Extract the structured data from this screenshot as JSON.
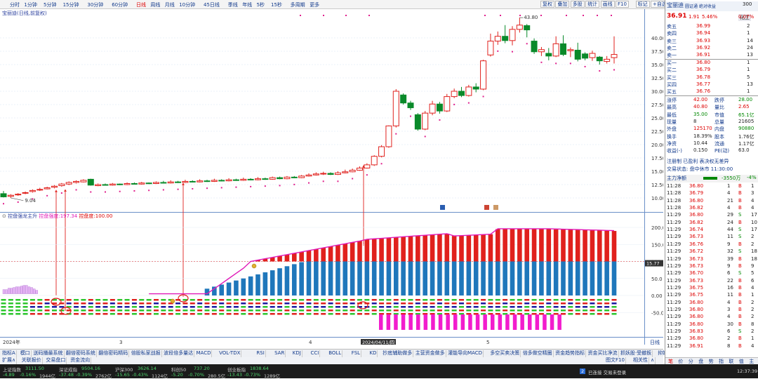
{
  "topbar": {
    "periods": [
      "分时",
      "1分钟",
      "5分钟",
      "15分钟",
      "30分钟",
      "60分钟",
      "日线",
      "周线",
      "月线",
      "10分钟",
      "45日线",
      "季线",
      "年线",
      "5秒",
      "15秒",
      "多周期",
      "更多"
    ],
    "active": "日线",
    "tools": [
      "复权",
      "叠加",
      "多股",
      "统计",
      "画线",
      "F10",
      "标记",
      "+自选",
      "返回"
    ]
  },
  "chart": {
    "title": "宝丽迪(日线,前复权)",
    "y_ticks": [
      "40.00",
      "37.50",
      "35.00",
      "32.50",
      "30.00",
      "27.50",
      "25.00",
      "22.50",
      "20.00",
      "17.50",
      "15.00",
      "12.50",
      "10.00"
    ],
    "high_label": "43.80",
    "low_label": "9.04",
    "x_labels": [
      "2024年",
      "3",
      "4",
      "5"
    ],
    "date_label": "2024/04/11/四",
    "chip_label": "日线",
    "price_tag": "15.77",
    "candles": [
      [
        10.8,
        10.2,
        11.3,
        10.1
      ],
      [
        10.3,
        10.5,
        10.7,
        10.0
      ],
      [
        10.6,
        10.7,
        10.9,
        10.4
      ],
      [
        10.9,
        11.0,
        11.2,
        10.7
      ],
      [
        11.2,
        11.4,
        11.6,
        11.0
      ],
      [
        11.5,
        11.6,
        11.9,
        11.3
      ],
      [
        11.7,
        11.9,
        12.1,
        11.6
      ],
      [
        12.0,
        12.2,
        12.4,
        11.8
      ],
      [
        12.3,
        12.6,
        12.8,
        12.1
      ],
      [
        12.6,
        12.9,
        13.1,
        12.4
      ],
      [
        12.9,
        13.1,
        13.3,
        12.7
      ],
      [
        13.0,
        13.3,
        13.5,
        12.9
      ],
      [
        13.5,
        12.4,
        13.6,
        12.3
      ],
      [
        12.3,
        12.5,
        12.7,
        12.2
      ],
      [
        12.5,
        12.4,
        12.7,
        12.3
      ],
      [
        12.4,
        12.6,
        12.8,
        12.3
      ],
      [
        12.6,
        12.5,
        12.7,
        12.4
      ],
      [
        12.5,
        12.7,
        12.9,
        12.4
      ],
      [
        12.7,
        12.6,
        12.9,
        12.5
      ],
      [
        12.6,
        12.8,
        13.0,
        12.5
      ],
      [
        12.8,
        12.7,
        12.9,
        12.6
      ],
      [
        12.7,
        12.9,
        13.1,
        12.6
      ],
      [
        12.9,
        12.8,
        13.2,
        12.7
      ],
      [
        12.8,
        13.0,
        13.3,
        12.7
      ],
      [
        13.0,
        12.9,
        13.2,
        12.8
      ],
      [
        12.9,
        13.1,
        13.4,
        12.8
      ],
      [
        13.1,
        13.0,
        13.3,
        12.9
      ],
      [
        13.0,
        13.2,
        13.5,
        12.9
      ],
      [
        13.2,
        13.1,
        13.4,
        13.0
      ],
      [
        13.1,
        13.3,
        13.6,
        13.0
      ],
      [
        13.3,
        13.2,
        13.5,
        13.1
      ],
      [
        13.2,
        13.4,
        13.7,
        13.1
      ],
      [
        13.4,
        13.3,
        13.6,
        13.2
      ],
      [
        13.3,
        13.5,
        13.8,
        13.2
      ],
      [
        13.5,
        13.4,
        13.7,
        13.3
      ],
      [
        13.4,
        13.6,
        13.9,
        13.3
      ],
      [
        13.6,
        13.5,
        13.8,
        13.4
      ],
      [
        13.5,
        13.8,
        14.0,
        13.4
      ],
      [
        13.8,
        13.6,
        14.0,
        13.5
      ],
      [
        13.6,
        13.9,
        14.1,
        13.5
      ],
      [
        13.9,
        13.8,
        14.1,
        13.7
      ],
      [
        13.8,
        14.1,
        14.3,
        13.7
      ],
      [
        14.1,
        14.3,
        14.6,
        14.0
      ],
      [
        14.3,
        14.5,
        14.8,
        14.2
      ],
      [
        14.5,
        14.6,
        14.9,
        14.3
      ],
      [
        14.6,
        14.4,
        14.8,
        14.3
      ],
      [
        14.4,
        14.7,
        15.0,
        14.3
      ],
      [
        14.7,
        14.9,
        15.3,
        14.6
      ],
      [
        14.9,
        15.2,
        15.5,
        14.8
      ],
      [
        15.2,
        15.6,
        15.9,
        15.1
      ],
      [
        15.6,
        16.2,
        16.5,
        15.5
      ],
      [
        16.2,
        17.8,
        18.0,
        16.0
      ],
      [
        17.8,
        19.6,
        19.9,
        17.6
      ],
      [
        19.6,
        23.5,
        23.6,
        19.4
      ],
      [
        23.5,
        30.0,
        30.4,
        23.2
      ],
      [
        29.3,
        27.8,
        29.6,
        27.5
      ],
      [
        27.8,
        26.9,
        28.2,
        26.5
      ],
      [
        25.6,
        22.9,
        25.9,
        22.6
      ],
      [
        22.9,
        25.9,
        26.3,
        22.7
      ],
      [
        25.9,
        27.6,
        28.2,
        25.5
      ],
      [
        27.6,
        26.3,
        28.0,
        25.8
      ],
      [
        26.3,
        29.0,
        29.5,
        26.1
      ],
      [
        29.0,
        30.0,
        30.5,
        28.7
      ],
      [
        30.0,
        29.2,
        30.8,
        28.9
      ],
      [
        29.2,
        30.8,
        31.2,
        29.0
      ],
      [
        30.8,
        30.4,
        31.5,
        29.8
      ],
      [
        30.4,
        35.7,
        35.9,
        30.2
      ],
      [
        36.8,
        39.4,
        40.8,
        36.5
      ],
      [
        39.4,
        40.3,
        41.2,
        38.7
      ],
      [
        40.3,
        39.5,
        42.4,
        39.0
      ],
      [
        39.5,
        41.6,
        42.2,
        38.6
      ],
      [
        41.6,
        42.4,
        43.8,
        41.0
      ],
      [
        42.3,
        41.5,
        42.6,
        40.1
      ],
      [
        39.4,
        37.4,
        39.9,
        37.0
      ],
      [
        37.4,
        37.8,
        38.3,
        36.6
      ],
      [
        37.1,
        36.6,
        38.1,
        35.8
      ],
      [
        36.6,
        38.9,
        40.3,
        36.4
      ],
      [
        38.9,
        36.9,
        40.5,
        36.6
      ],
      [
        37.6,
        37.8,
        38.2,
        36.4
      ],
      [
        37.7,
        36.0,
        39.1,
        35.6
      ],
      [
        37.0,
        36.2,
        37.3,
        35.8
      ],
      [
        36.3,
        37.1,
        37.6,
        35.7
      ],
      [
        36.4,
        35.7,
        36.6,
        35.0
      ],
      [
        35.6,
        36.0,
        36.6,
        35.2
      ],
      [
        36.3,
        36.9,
        40.3,
        35.2
      ]
    ]
  },
  "indicator": {
    "name": "控盘强龙主升",
    "line1_label": "控盘强度:",
    "line1_value": "197.34",
    "line2_label": "控盘度:",
    "line2_value": "100.00",
    "y_ticks": [
      "200.0",
      "150.0",
      "100.0",
      "50.0",
      "0.00",
      "-50.0"
    ],
    "curve": [
      5,
      5,
      5,
      5,
      5,
      5,
      5,
      5,
      5,
      5,
      5,
      5,
      5,
      5,
      5,
      5,
      5,
      5,
      5,
      5,
      5,
      5,
      5,
      5,
      5,
      5,
      5,
      5,
      5,
      5,
      5,
      5,
      5,
      5,
      5,
      5,
      5,
      5,
      5,
      5,
      5,
      5,
      5,
      5,
      5,
      5,
      5,
      10,
      18,
      28,
      40,
      55,
      70,
      85,
      100,
      112,
      120,
      130,
      140,
      150,
      155,
      160,
      165,
      170,
      173,
      175,
      177,
      178,
      180,
      181,
      182,
      183,
      184,
      184,
      185,
      186,
      186,
      187,
      188,
      189,
      190,
      190,
      190,
      191,
      192,
      193,
      194,
      195,
      196,
      197,
      197,
      198,
      199,
      200,
      201,
      202,
      203,
      204,
      205,
      205,
      205,
      205,
      205,
      205,
      205,
      205,
      205,
      205,
      205,
      205,
      205,
      205,
      205,
      205,
      205,
      205,
      205,
      205,
      205,
      205,
      205,
      205,
      205,
      205,
      205,
      205,
      205,
      205,
      205,
      205,
      205,
      205,
      205,
      205,
      205,
      205,
      205,
      205,
      205,
      205,
      205,
      205,
      205,
      205,
      205,
      205,
      205,
      205,
      205,
      205,
      205,
      205,
      205,
      205,
      205,
      205,
      205,
      205,
      205,
      205,
      205,
      205,
      205,
      205,
      205,
      205,
      205,
      205,
      205,
      205,
      205,
      205,
      205,
      205,
      205,
      205,
      205,
      205,
      205,
      205,
      205,
      205,
      205,
      205,
      205,
      205,
      205,
      205,
      205,
      205,
      205,
      205,
      205,
      205,
      205,
      205,
      205,
      205,
      205,
      205,
      205,
      205,
      205,
      205,
      205,
      205,
      205,
      205,
      205,
      205,
      205,
      205,
      205,
      205,
      205,
      205,
      205,
      205,
      205,
      205,
      205,
      205,
      205,
      205,
      205,
      205,
      205,
      205,
      205
    ]
  },
  "quote": {
    "name": "宝丽迪",
    "sector": "化工",
    "ticker": "300",
    "subtitle": "圆证通 绝对收益",
    "price": "36.91",
    "change": "1.91",
    "pct": "5.46%",
    "weibi": "0.07%",
    "asks": [
      [
        "卖五",
        "36.99",
        "2"
      ],
      [
        "卖四",
        "36.94",
        "1"
      ],
      [
        "卖三",
        "36.93",
        "14"
      ],
      [
        "卖二",
        "36.92",
        "24"
      ],
      [
        "卖一",
        "36.91",
        "13"
      ]
    ],
    "bids": [
      [
        "买一",
        "36.80",
        "1"
      ],
      [
        "买二",
        "36.79",
        "1"
      ],
      [
        "买三",
        "36.78",
        "5"
      ],
      [
        "买四",
        "36.77",
        "13"
      ],
      [
        "买五",
        "36.76",
        "1"
      ]
    ],
    "stats": [
      [
        "涨停",
        "42.00",
        "跌停",
        "28.00"
      ],
      [
        "最高",
        "40.80",
        "量比",
        "2.65"
      ],
      [
        "最低",
        "35.00",
        "市值",
        "65.1亿"
      ],
      [
        "现量",
        "8",
        "总量",
        "21605"
      ],
      [
        "外盘",
        "125170",
        "内盘",
        "90880"
      ],
      [
        "换手",
        "18.39%",
        "股本",
        "1.76亿"
      ],
      [
        "净资",
        "10.44",
        "流通",
        "1.17亿"
      ],
      [
        "收益(-)",
        "0.150",
        "PE(动)",
        "63.0"
      ]
    ],
    "tags": "注册制 已盈利 表决权无差异",
    "status": "交易状态: 盘中休市 11:30:00",
    "flow_label": "主力净额",
    "flow_value": "-3550万",
    "flow_pct": "-4%",
    "ticks": [
      [
        "11:28",
        "36.80",
        "1",
        "B",
        "1"
      ],
      [
        "11:28",
        "36.79",
        "4",
        "B",
        "3"
      ],
      [
        "11:28",
        "36.80",
        "21",
        "B",
        "4"
      ],
      [
        "11:28",
        "36.82",
        "4",
        "B",
        "4"
      ],
      [
        "11:29",
        "36.80",
        "29",
        "S",
        "17"
      ],
      [
        "11:29",
        "36.82",
        "24",
        "B",
        "10"
      ],
      [
        "11:29",
        "36.74",
        "44",
        "S",
        "17"
      ],
      [
        "11:29",
        "36.73",
        "11",
        "S",
        "2"
      ],
      [
        "11:29",
        "36.76",
        "9",
        "B",
        "2"
      ],
      [
        "11:29",
        "36.72",
        "32",
        "S",
        "18"
      ],
      [
        "11:29",
        "36.73",
        "39",
        "B",
        "18"
      ],
      [
        "11:29",
        "36.73",
        "9",
        "B",
        "9"
      ],
      [
        "11:29",
        "36.70",
        "6",
        "S",
        "5"
      ],
      [
        "11:29",
        "36.73",
        "22",
        "B",
        "6"
      ],
      [
        "11:29",
        "36.75",
        "16",
        "B",
        "4"
      ],
      [
        "11:29",
        "36.75",
        "11",
        "B",
        "1"
      ],
      [
        "11:29",
        "36.80",
        "4",
        "B",
        "2"
      ],
      [
        "11:29",
        "36.80",
        "3",
        "B",
        "2"
      ],
      [
        "11:29",
        "36.80",
        "4",
        "B",
        "2"
      ],
      [
        "11:29",
        "36.80",
        "30",
        "B",
        "8"
      ],
      [
        "11:29",
        "36.83",
        "6",
        "S",
        "2"
      ],
      [
        "11:29",
        "36.80",
        "2",
        "B",
        "1"
      ],
      [
        "11:29",
        "36.91",
        "8",
        "B",
        "4"
      ]
    ],
    "bottom_tabs": [
      "笔",
      "价",
      "分",
      "盘",
      "势",
      "指",
      "联",
      "值",
      "主"
    ]
  },
  "tabs": [
    "指标A",
    "模口",
    "送码播最系统",
    "翻倍密码系统",
    "翻倍密码精码",
    "倍股私家战报",
    "波段倍多量达",
    "MACD",
    "VOL-TDX",
    "RSI",
    "SAR",
    "KDJ",
    "CCI",
    "BOLL",
    "FSL",
    "KD",
    "抄底辅助做多",
    "主营资金做多",
    "灌能导向MACD",
    "多空买卖决策",
    "倍多做空精圈",
    "资金趋势指标",
    "资金买比净流",
    "抓妖股·受撤板",
    "抑妖伏魔精",
    "指标B",
    "模",
    "板"
  ],
  "tabs_row2": [
    "扩展∧",
    "关联报价",
    "交易盘口",
    "资金流向"
  ],
  "tabs_right": [
    "图文F10",
    "相关性",
    "∧"
  ],
  "status": {
    "indices": [
      [
        "上证指数",
        "3111.50",
        "-4.89",
        "-0.16%",
        "1944亿"
      ],
      [
        "深证成指",
        "9504.16",
        "-37.48",
        "-0.39%",
        "2762亿"
      ],
      [
        "沪深300",
        "3626.14",
        "-15.65",
        "-0.43%",
        "1124亿"
      ],
      [
        "科创50",
        "737.20",
        "-5.20",
        "-0.70%",
        "280.5亿"
      ],
      [
        "创业板指",
        "1838.64",
        "-13.43",
        "-0.73%",
        "1289亿"
      ]
    ],
    "conn": "已连接 交易未登录",
    "time": "12:37:39"
  }
}
